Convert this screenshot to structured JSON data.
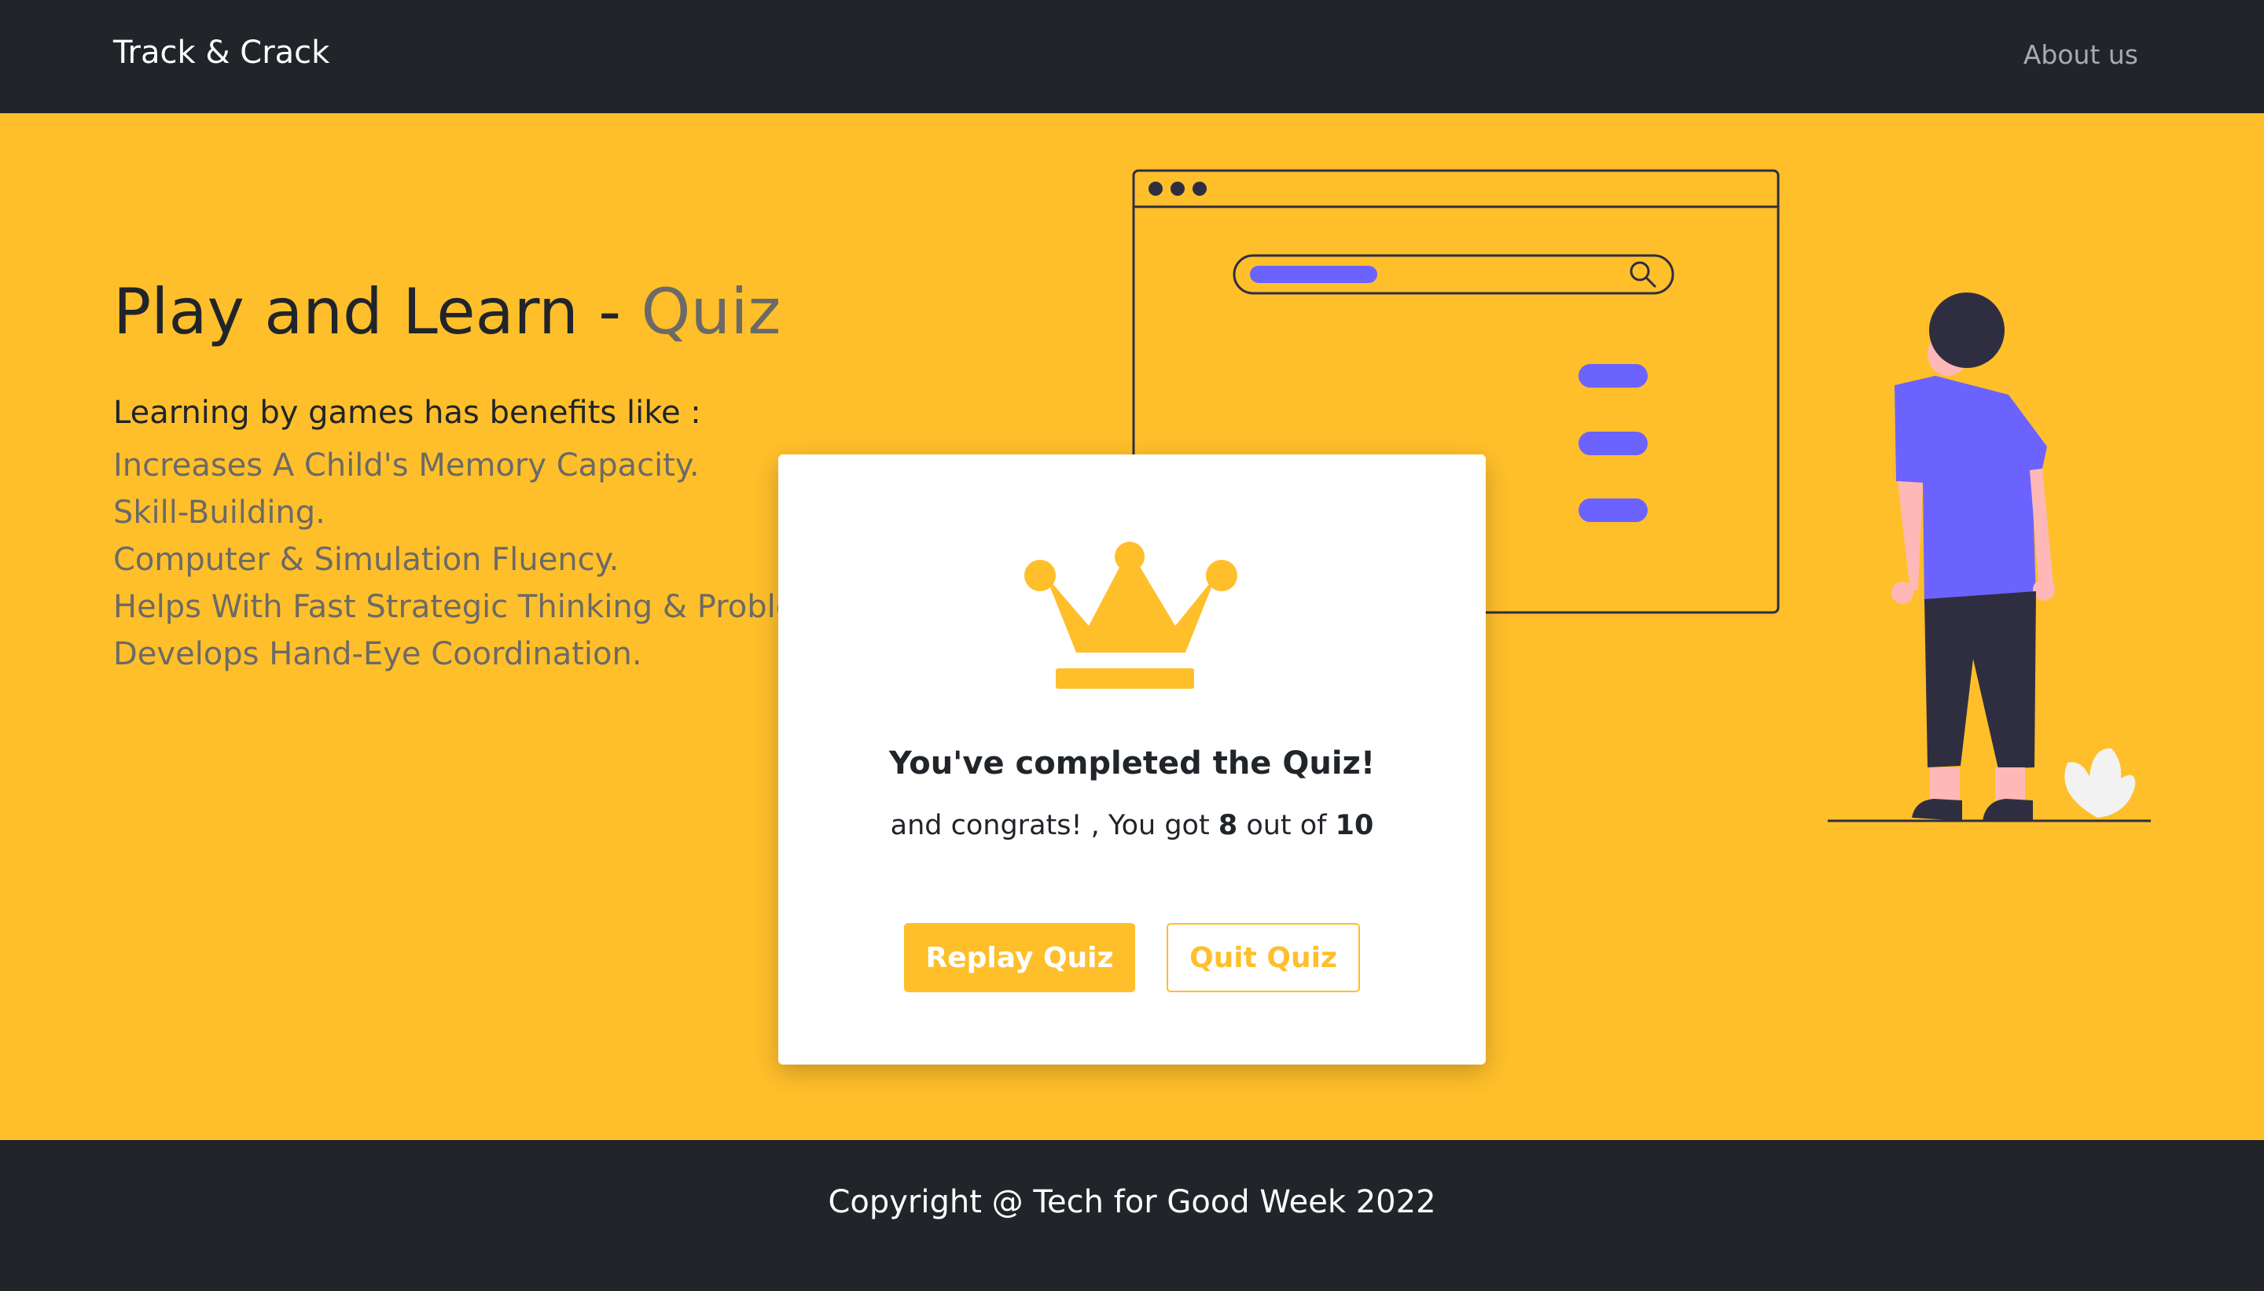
{
  "navbar": {
    "brand": "Track & Crack",
    "about_link": "About us"
  },
  "hero": {
    "title_main": "Play and Learn - ",
    "title_accent": "Quiz",
    "intro": "Learning by games has benefits like :",
    "benefits": [
      "Increases A Child's Memory Capacity.",
      "Skill-Building.",
      "Computer & Simulation Fluency.",
      "Helps With Fast Strategic Thinking & Problem-Solving.",
      "Develops Hand-Eye Coordination."
    ]
  },
  "modal": {
    "icon": "crown-icon",
    "title": "You've completed the Quiz!",
    "score_prefix": "and congrats! , You got ",
    "score_value": "8",
    "score_middle": " out of ",
    "score_total": "10",
    "replay_label": "Replay Quiz",
    "quit_label": "Quit Quiz"
  },
  "footer": {
    "copyright": "Copyright @ Tech for Good Week 2022"
  },
  "colors": {
    "accent": "#ffbf2b",
    "dark": "#212529",
    "muted_text": "#6c6a66",
    "illustration_purple": "#6c63ff"
  }
}
